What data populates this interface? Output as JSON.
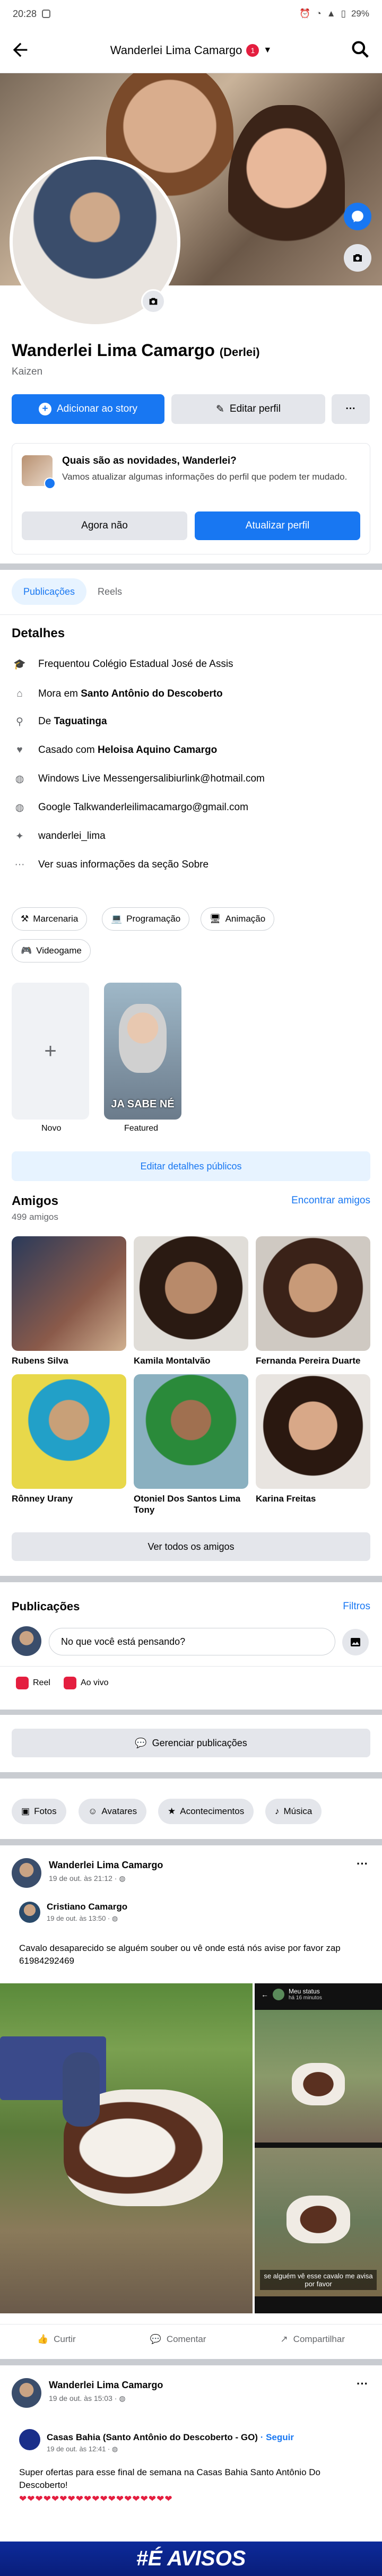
{
  "status_bar": {
    "time": "20:28",
    "battery": "29%"
  },
  "header": {
    "title": "Wanderlei Lima Camargo",
    "badge": "1"
  },
  "profile": {
    "name": "Wanderlei Lima Camargo",
    "nickname": "(Derlei)",
    "subtitle": "Kaizen",
    "add_story": "Adicionar ao story",
    "edit_profile": "Editar perfil",
    "more": "···"
  },
  "update_card": {
    "title": "Quais são as novidades, Wanderlei?",
    "text": "Vamos atualizar algumas informações do perfil que podem ter mudado.",
    "not_now": "Agora não",
    "update": "Atualizar perfil"
  },
  "tabs": {
    "posts": "Publicações",
    "reels": "Reels"
  },
  "details": {
    "title": "Detalhes",
    "items": [
      {
        "icon": "graduation-cap-icon",
        "text": "Frequentou Colégio Estadual José de Assis",
        "bold": ""
      },
      {
        "icon": "home-icon",
        "text": "Mora em ",
        "bold": "Santo Antônio do Descoberto"
      },
      {
        "icon": "location-pin-icon",
        "text": "De ",
        "bold": "Taguatinga"
      },
      {
        "icon": "heart-icon",
        "text": "Casado com ",
        "bold": "Heloisa Aquino Camargo"
      },
      {
        "icon": "globe-icon",
        "text": "Windows Live Messengersalibiurlink@hotmail.com",
        "bold": ""
      },
      {
        "icon": "globe-icon",
        "text": "Google Talkwanderleilimacamargo@gmail.com",
        "bold": ""
      },
      {
        "icon": "twitter-icon",
        "text": "wanderlei_lima",
        "bold": ""
      },
      {
        "icon": "more-icon",
        "text": "Ver suas informações da seção Sobre",
        "bold": ""
      }
    ],
    "hobbies": [
      "Marcenaria",
      "Programação",
      "Animação",
      "Videogame"
    ],
    "featured_new": "Novo",
    "featured_label": "Featured",
    "featured_caption": "JA SABE NÉ",
    "edit_public": "Editar detalhes públicos"
  },
  "friends": {
    "title": "Amigos",
    "count": "499 amigos",
    "find": "Encontrar amigos",
    "list": [
      {
        "name": "Rubens Silva",
        "color": "#8a5a4a"
      },
      {
        "name": "Kamila Montalvão",
        "color": "#b88a6a"
      },
      {
        "name": "Fernanda Pereira Duarte",
        "color": "#9a7050"
      },
      {
        "name": "Rônney Urany",
        "color": "#d8c24a"
      },
      {
        "name": "Otoniel Dos Santos Lima Tony",
        "color": "#4a8a4a"
      },
      {
        "name": "Karina Freitas",
        "color": "#5a3a2a"
      }
    ],
    "see_all": "Ver todos os amigos"
  },
  "posts_section": {
    "title": "Publicações",
    "filters": "Filtros",
    "composer_placeholder": "No que você está pensando?",
    "reel": "Reel",
    "live": "Ao vivo",
    "manage": "Gerenciar publicações",
    "chips": [
      "Fotos",
      "Avatares",
      "Acontecimentos",
      "Música"
    ]
  },
  "post1": {
    "author": "Wanderlei Lima Camargo",
    "time": "19 de out. às 21:12 · ",
    "shared_author": "Cristiano Camargo",
    "shared_time": "19 de out. às 13:50 · ",
    "text": "Cavalo desaparecido se alguém souber ou vê onde está nós avise por favor zap 61984292469",
    "story_title": "Meu status",
    "story_time": "há 16 minutos",
    "overlay_text": "se alguém vê esse cavalo me avisa por favor",
    "like": "Curtir",
    "comment": "Comentar",
    "share": "Compartilhar"
  },
  "post2": {
    "author": "Wanderlei Lima Camargo",
    "time": "19 de out. às 15:03 · ",
    "shared_author": "Casas Bahia (Santo Antônio do Descoberto - GO)",
    "follow": "· Seguir",
    "shared_time": "19 de out. às 12:41 · ",
    "text": "Super ofertas para esse final de semana na Casas Bahia Santo Antônio Do Descoberto!",
    "hearts": "❤❤❤❤❤❤❤❤❤❤❤❤❤❤❤❤❤❤❤",
    "banner": "#É AVISOS"
  }
}
